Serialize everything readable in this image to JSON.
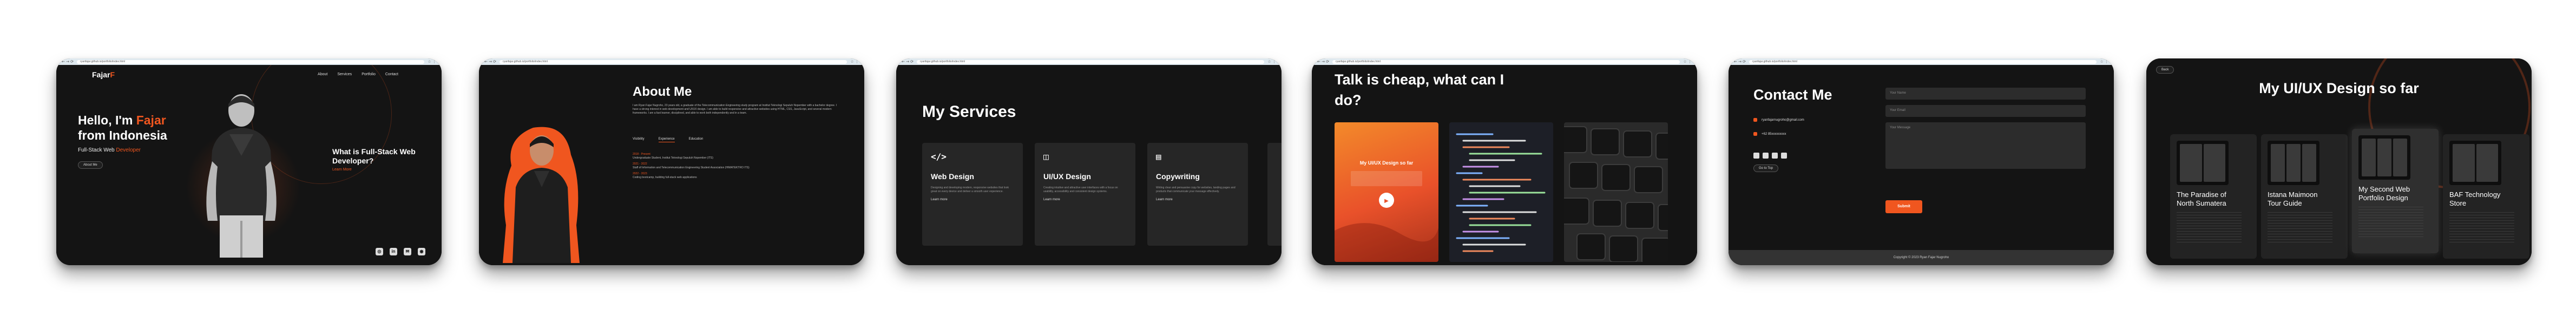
{
  "browser": {
    "nav": "← → ⟳",
    "url": "ryanfajar.github.io/portfolio/index.html",
    "ext": "☆ ⋮"
  },
  "hero": {
    "logo": "Fajar",
    "logo_mark": "F",
    "menu": [
      "About",
      "Services",
      "Portfolio",
      "Contact"
    ],
    "hello_prefix": "Hello, I'm ",
    "hello_name": "Fajar",
    "hello_suffix": "from Indonesia",
    "role_prefix": "Full-Stack Web ",
    "role_accent": "Developer",
    "about_button": "About Me",
    "question": "What is Full-Stack Web Developer?",
    "question_link": "Learn More",
    "socials": [
      "instagram-icon",
      "linkedin-icon",
      "mail-icon",
      "github-icon"
    ],
    "accent_color": "#f0561f"
  },
  "about": {
    "title": "About Me",
    "paragraph": "I am Ryan Fajar Nugroho, 23 years old, a graduate of the Telecommunication Engineering study program at Institut Teknologi Sepuluh Nopember with a bachelor degree. I have a strong interest in web development and UI/UX design. I am able to build responsive and attractive websites using HTML, CSS, JavaScript, and several modern frameworks. I am a fast learner, disciplined, and able to work both independently and in a team.",
    "tabs": [
      "Visibility",
      "Experience",
      "Education"
    ],
    "active_tab": 1,
    "items": [
      {
        "period": "2018 - Present",
        "text": "Undergraduate Student, Institut Teknologi Sepuluh Nopember (ITS)"
      },
      {
        "period": "2021 - 2022",
        "text": "Staff of Information and Telecommunication Engineering Student Association (HIMATEKTRO ITS)"
      },
      {
        "period": "2022 - 2023",
        "text": "Coding bootcamp, building full-stack web applications"
      }
    ]
  },
  "services": {
    "title": "My Services",
    "items": [
      {
        "icon": "</>",
        "name": "Web Design",
        "desc": "Designing and developing modern, responsive websites that look great on every device and deliver a smooth user experience.",
        "more": "Learn more"
      },
      {
        "icon": "◫",
        "name": "UI/UX Design",
        "desc": "Creating intuitive and attractive user interfaces with a focus on usability, accessibility and consistent design systems.",
        "more": "Learn more"
      },
      {
        "icon": "▤",
        "name": "Copywriting",
        "desc": "Writing clear and persuasive copy for websites, landing pages and products that communicate your message effectively.",
        "more": "Learn more"
      }
    ]
  },
  "portfolio_intro": {
    "title": "Talk is cheap, what can I do?",
    "image1_caption": "My UI/UX Design so far",
    "play_label": "▶"
  },
  "contact": {
    "title": "Contact Me",
    "email": "ryanfajarnugroho@gmail.com",
    "phone": "+62 85xxxxxxxxx",
    "top_button": "Go to Top",
    "fields": {
      "name": "Your Name",
      "email": "Your Email",
      "message": "Your Message"
    },
    "send": "Submit",
    "footer": "Copyright © 2023 Ryan Fajar Nugroho"
  },
  "uiux": {
    "back": "Back",
    "title": "My UI/UX Design so far",
    "projects": [
      {
        "name": "The Paradise of North Sumatera"
      },
      {
        "name": "Istana Maimoon Tour Guide"
      },
      {
        "name": "My Second Web Portfolio Design"
      },
      {
        "name": "BAF Technology Store"
      }
    ]
  }
}
